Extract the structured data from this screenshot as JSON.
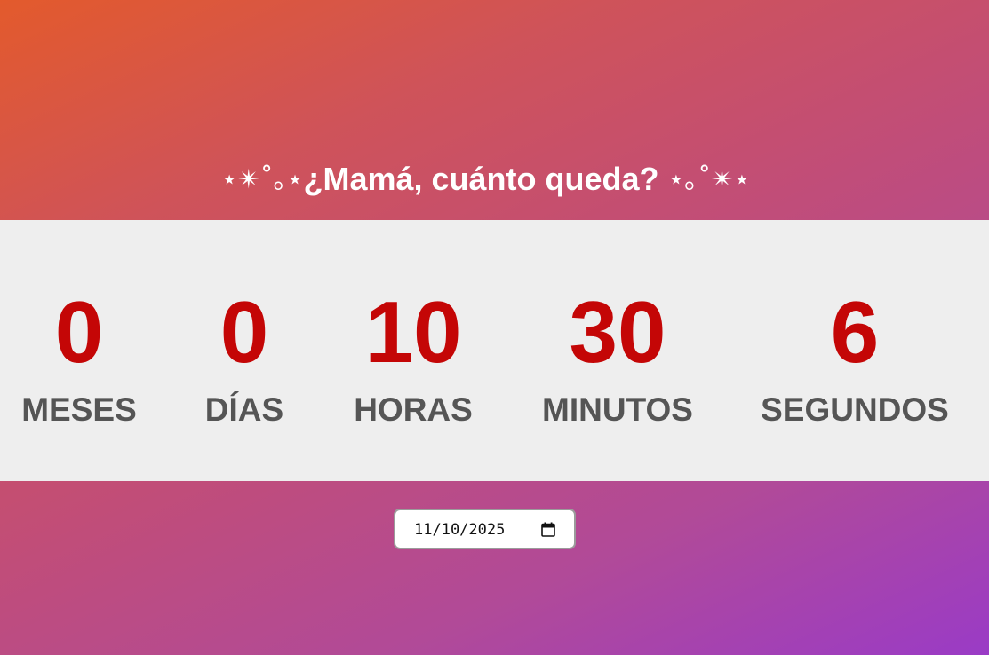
{
  "header": {
    "deco_left": "⋆✴︎˚｡⋆",
    "title": "¿Mamá, cuánto queda?",
    "deco_right": "⋆｡˚✴︎⋆"
  },
  "countdown": [
    {
      "value": "0",
      "label": "MESES"
    },
    {
      "value": "0",
      "label": "DÍAS"
    },
    {
      "value": "10",
      "label": "HORAS"
    },
    {
      "value": "30",
      "label": "MINUTOS"
    },
    {
      "value": "6",
      "label": "SEGUNDOS"
    }
  ],
  "date_picker": {
    "value": "11/10/2025",
    "icon": "calendar-icon"
  },
  "colors": {
    "number": "#c40606",
    "label": "#555555",
    "band": "#eeeeee",
    "gradient_start": "#e35a2c",
    "gradient_end": "#9a3bc6"
  }
}
